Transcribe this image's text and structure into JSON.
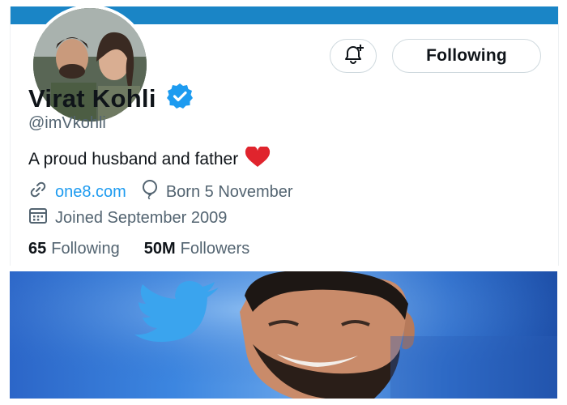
{
  "profile": {
    "name": "Virat Kohli",
    "handle": "@imVkohli",
    "bio": "A proud husband and father",
    "website": "one8.com",
    "birthday": "Born 5 November",
    "joined": "Joined September 2009",
    "following_count": "65",
    "following_label": "Following",
    "followers_count": "50M",
    "followers_label": "Followers"
  },
  "actions": {
    "follow_button_label": "Following",
    "notify_icon": "bell-plus-icon"
  },
  "colors": {
    "banner": "#1a85c6",
    "verified": "#1d9bf0",
    "link": "#1d9bf0",
    "heart": "#e0242d",
    "twitter_bird": "#3aa4ee"
  }
}
